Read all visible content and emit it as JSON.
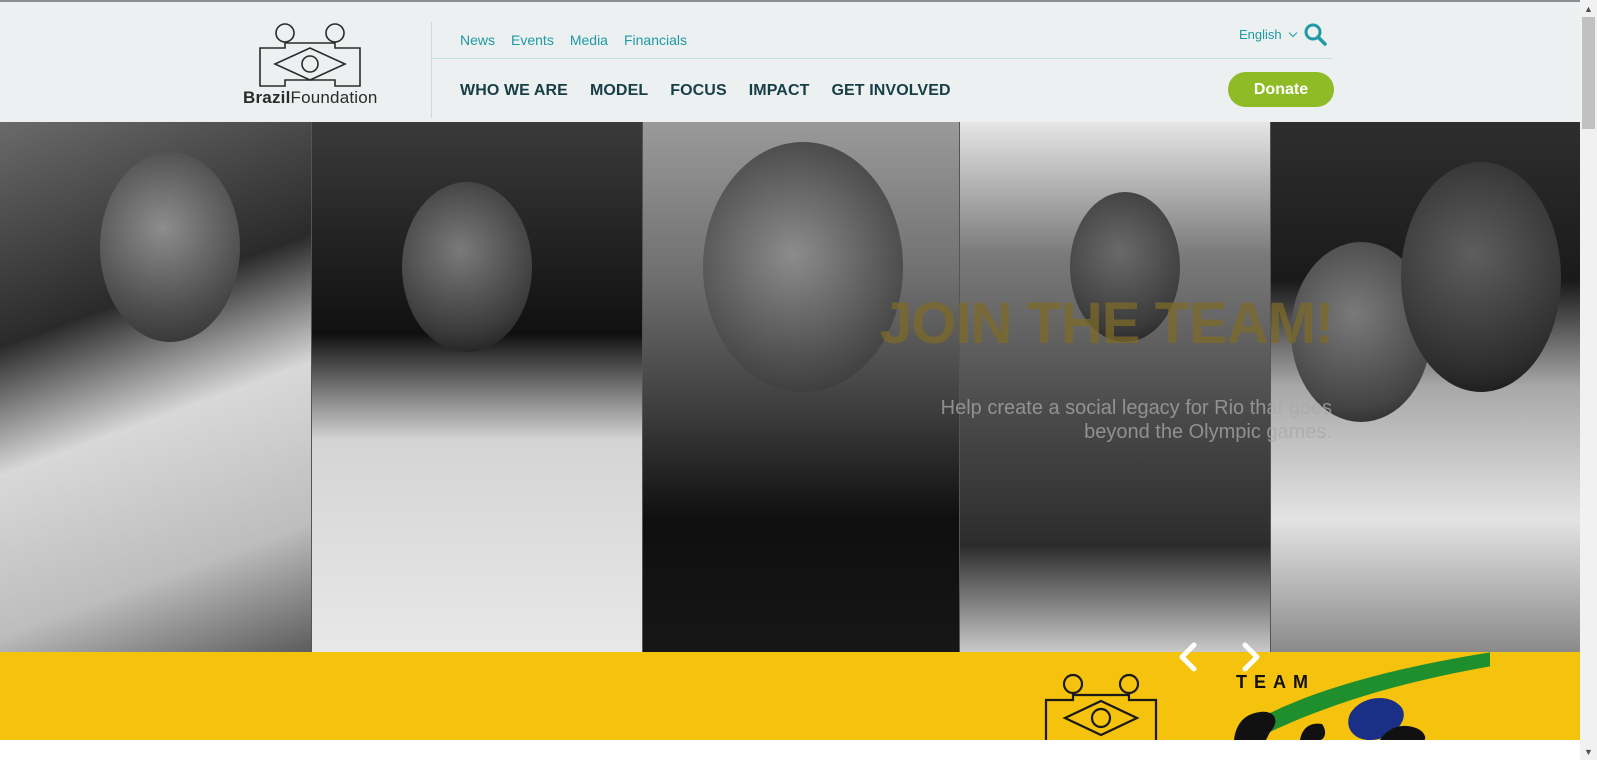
{
  "header": {
    "logo": {
      "name_bold": "Brazil",
      "name_rest": "Foundation"
    },
    "util_nav": [
      {
        "label": "News"
      },
      {
        "label": "Events"
      },
      {
        "label": "Media"
      },
      {
        "label": "Financials"
      }
    ],
    "main_nav": [
      {
        "label": "WHO WE ARE"
      },
      {
        "label": "MODEL"
      },
      {
        "label": "FOCUS"
      },
      {
        "label": "IMPACT"
      },
      {
        "label": "GET INVOLVED"
      }
    ],
    "language": {
      "selected": "English"
    },
    "search_icon": "search-icon",
    "donate_label": "Donate"
  },
  "hero": {
    "title": "JOIN THE TEAM!",
    "subtitle": "Help create a social legacy for Rio that goes beyond the Olympic games.",
    "prev_icon": "chevron-left-icon",
    "next_icon": "chevron-right-icon"
  },
  "band": {
    "team_word": "TEAM"
  },
  "colors": {
    "accent_teal": "#1f9aa6",
    "nav_dark": "#173e47",
    "donate_green": "#8fbc26",
    "band_yellow": "#f5c20d",
    "header_bg": "#ecf0f0"
  }
}
